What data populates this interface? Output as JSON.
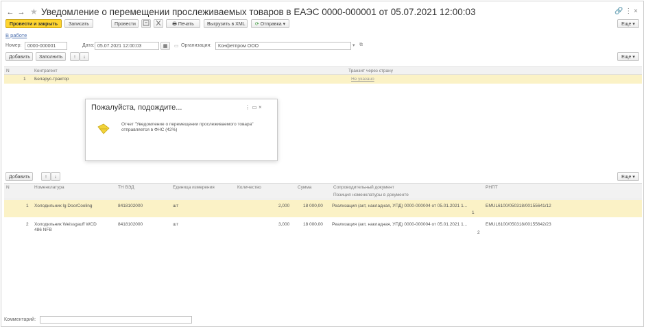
{
  "window": {
    "title": "Уведомление о перемещении прослеживаемых товаров в ЕАЭС 0000-000001 от 05.07.2021 12:00:03",
    "back": "←",
    "forward": "→",
    "star": "★",
    "right_controls": "🔗 ⋮ ×"
  },
  "toolbar": {
    "post_close": "Провести и закрыть",
    "save": "Записать",
    "post": "Провести",
    "print": "Печать",
    "upload_xml": "Выгрузить в XML",
    "send": "Отправка",
    "more": "Еще"
  },
  "status_link": "В работе",
  "header": {
    "number_label": "Номер:",
    "number_value": "0000-000001",
    "date_label": "Дата:",
    "date_value": "05.07.2021 12:00:03",
    "org_label": "Организация:",
    "org_value": "Конфетпром ООО"
  },
  "table1": {
    "add": "Добавить",
    "fill": "Заполнить",
    "more": "Еще",
    "columns": [
      "N",
      "Контрагент",
      "Транзит через страну"
    ],
    "rows": [
      {
        "n": "1",
        "contractor": "Беларус-трактор",
        "transit": "Не указано"
      }
    ]
  },
  "dialog": {
    "title": "Пожалуйста, подождите...",
    "controls": "⋮  ▭  ×",
    "message": "Отчет \"Уведомление о перемещении прослеживаемого товара\" отправляется в ФНС (42%)"
  },
  "table2": {
    "add": "Добавить",
    "more": "Еще",
    "columns": [
      "N",
      "Номенклатура",
      "ТН ВЭД",
      "Единица измерения",
      "Количество",
      "Сумма",
      "Сопроводительный документ",
      "РНПТ"
    ],
    "subheader": "Позиция номенклатуры в документе",
    "rows": [
      {
        "n": "1",
        "item": "Холодильник lg DoorCooling",
        "tnved": "8418102000",
        "unit": "шт",
        "qty": "2,000",
        "sum": "18 000,00",
        "doc": "Реализация (акт, накладная, УПД) 0000-000004 от 05.01.2021 1...",
        "pos": "1",
        "rnpt": "EMUL6100/050318/00155641/12"
      },
      {
        "n": "2",
        "item": "Холодильник Weissgauff WCD 486 NFB",
        "tnved": "8418102000",
        "unit": "шт",
        "qty": "3,000",
        "sum": "18 000,00",
        "doc": "Реализация (акт, накладная, УПД) 0000-000004 от 05.01.2021 1...",
        "pos": "2",
        "rnpt": "EMUL6100/050318/00155642/23"
      }
    ]
  },
  "footer": {
    "comment_label": "Комментарий:"
  },
  "colors": {
    "primary_button": "#ffd52f",
    "selected_row": "#fbf2c6",
    "link": "#4b6fae"
  }
}
